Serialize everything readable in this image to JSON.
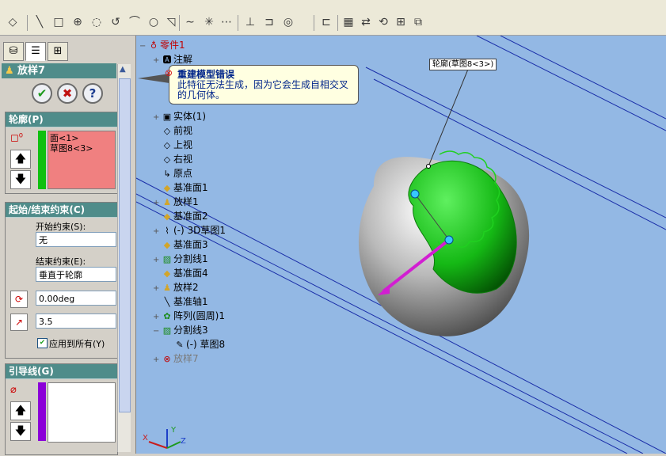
{
  "property_manager": {
    "title": "放样7",
    "ok_label": "✔",
    "cancel_label": "✖",
    "help_label": "?",
    "profile": {
      "header": "轮廓(P)",
      "items": [
        "面<1>",
        "草图8<3>"
      ]
    },
    "constraints": {
      "header": "起始/结束约束(C)",
      "start_label": "开始约束(S):",
      "start_value": "无",
      "end_label": "结束约束(E):",
      "end_value": "垂直于轮廓",
      "angle_value": "0.00deg",
      "length_value": "3.5",
      "apply_all_label": "应用到所有(Y)"
    },
    "guides": {
      "header": "引导线(G)"
    }
  },
  "tree": {
    "root": "零件1",
    "items": [
      {
        "label": "注解"
      },
      {
        "label": "实体(1)"
      },
      {
        "label": "前视"
      },
      {
        "label": "上视"
      },
      {
        "label": "右视"
      },
      {
        "label": "原点"
      },
      {
        "label": "基准面1"
      },
      {
        "label": "放样1"
      },
      {
        "label": "基准面2"
      },
      {
        "label": "(-)  3D草图1"
      },
      {
        "label": "基准面3"
      },
      {
        "label": "分割线1"
      },
      {
        "label": "基准面4"
      },
      {
        "label": "放样2"
      },
      {
        "label": "基准轴1"
      },
      {
        "label": "阵列(圆周)1"
      },
      {
        "label": "分割线3"
      },
      {
        "label": "(-)  草图8"
      },
      {
        "label": "放样7"
      }
    ]
  },
  "error_balloon": {
    "title": "重建模型错误",
    "message": "此特征无法生成，因为它会生成自相交叉的几何体。"
  },
  "viewport": {
    "sketch_label": "轮廓(草图8<3>)",
    "background_color": "#93b8e4",
    "accent_green": "#10c010"
  },
  "axes": {
    "x": "X",
    "y": "Y",
    "z": "Z"
  }
}
